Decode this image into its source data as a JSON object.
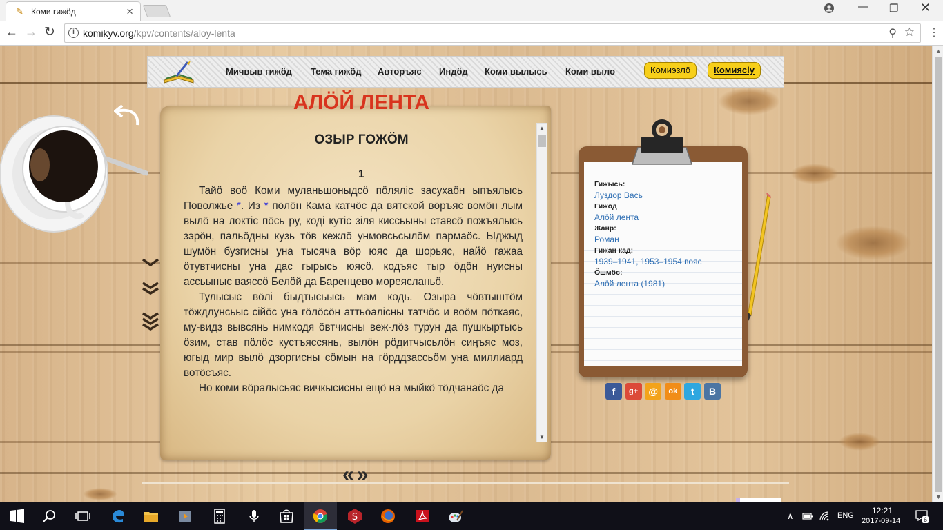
{
  "browser": {
    "tab_title": "Коми гижӧд",
    "url_host": "komikyv.org",
    "url_path": "/kpv/contents/aloy-lenta"
  },
  "site_nav": {
    "items": [
      "Мичвыв гижӧд",
      "Тема гижӧд",
      "Авторъяс",
      "Индӧд",
      "Коми вылысь",
      "Коми выло"
    ],
    "pill_1": "Комиэзлӧ",
    "pill_2": "Комиясly"
  },
  "article": {
    "title": "АЛӦЙ ЛЕНТА",
    "subtitle": "ОЗЫР ГОЖӦМ",
    "chapter": "1",
    "p1_a": "Тайӧ воӧ Коми муланьшоныдсӧ пӧлялiс засухаӧн ыпъялысь Поволжье ",
    "p1_note1": "*",
    "p1_b": ". Из ",
    "p1_note2": "*",
    "p1_c": " пӧлӧн Кама катчӧс да вятской вӧръяс вомӧн лым вылӧ на локтiс пӧсь ру, кодi кутiс зiля киссьыны ставсӧ пожъялысь зэрӧн, пальӧдны кузь тӧв кежлӧ унмовсьсылӧм пармаӧс. Ыджыд шумӧн бузгисны уна тысяча вӧр юяс да шорьяс, найӧ гажаа ӧтувтчисны уна дас гырысь юясӧ, кодъяс тыр ӧдӧн нуисны ассьыныс ваяссӧ Белӧй да Баренцево мореясланьӧ.",
    "p2": "Тулысыс вӧлi быдтысьысь мам кодь. Озыра чӧвтыштӧм тӧждлунсьыс сiйӧс уна гӧлӧсӧн аттьӧалiсны татчӧс и воӧм пӧткаяс, му-видз вывсянь нимкодя ӧвтчисны веж-лӧз турун да пушкыртысь ӧзим, став пӧлӧс кустъяссянь, вылӧн рӧдитчысьлӧн сиӊъяс моз, югыд мир вылӧ дзоргисны сӧмын на гӧрддзассьӧм уна миллиард вотӧсъяс.",
    "p3": "Но коми вӧралысьяс вичкысисны ещӧ на мыйкӧ тӧдчанаӧс да"
  },
  "pager": {
    "prev": "«",
    "next": "»"
  },
  "meta": {
    "author_label": "Гижысь:",
    "author": "Луздор Вась",
    "work_label": "Гижӧд",
    "work": "Алӧй лента",
    "genre_label": "Жанр:",
    "genre": "Роман",
    "time_label": "Гижан кад:",
    "time": "1939–1941, 1953–1954 вояс",
    "source_label": "Ӧшмӧс:",
    "source": "Алӧй лента (1981)"
  },
  "share": [
    {
      "name": "facebook-icon",
      "glyph": "f",
      "color": "#3b5998"
    },
    {
      "name": "google-plus-icon",
      "glyph": "g+",
      "color": "#dc4a38"
    },
    {
      "name": "mail-icon",
      "glyph": "@",
      "color": "#f3a31b"
    },
    {
      "name": "odnoklassniki-icon",
      "glyph": "ok",
      "color": "#f18d18"
    },
    {
      "name": "twitter-icon",
      "glyph": "t",
      "color": "#2ea7e0"
    },
    {
      "name": "vk-icon",
      "glyph": "B",
      "color": "#4c75a3"
    }
  ],
  "taskbar": {
    "lang": "ENG",
    "time": "12:21",
    "date": "2017-09-14",
    "notif_count": "6"
  }
}
